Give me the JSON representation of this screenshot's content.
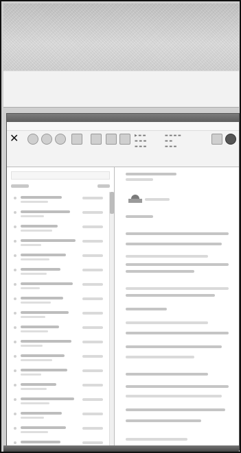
{
  "window": {
    "title": ""
  },
  "menubar": {
    "items": [
      "",
      ""
    ]
  },
  "ribbon": {
    "delete_glyph": "✕",
    "groups": [
      "",
      "",
      ""
    ],
    "buttons": [
      "",
      "",
      "",
      "",
      "",
      "",
      "",
      "",
      "",
      "",
      "",
      ""
    ]
  },
  "colors": {
    "frame_border": "#111111",
    "app_background": "#ffffff",
    "ribbon_background": "#f3f3f3",
    "text_placeholder": "#c5c5c5"
  },
  "icons": {
    "delete": "close-icon",
    "help": "help-icon",
    "avatar": "person-icon"
  },
  "message_list": {
    "items": [
      {
        "subject": "",
        "date": ""
      },
      {
        "subject": "",
        "date": ""
      },
      {
        "subject": "",
        "date": ""
      },
      {
        "subject": "",
        "date": ""
      },
      {
        "subject": "",
        "date": ""
      },
      {
        "subject": "",
        "date": ""
      },
      {
        "subject": "",
        "date": ""
      },
      {
        "subject": "",
        "date": ""
      },
      {
        "subject": "",
        "date": ""
      },
      {
        "subject": "",
        "date": ""
      },
      {
        "subject": "",
        "date": ""
      },
      {
        "subject": "",
        "date": ""
      },
      {
        "subject": "",
        "date": ""
      },
      {
        "subject": "",
        "date": ""
      },
      {
        "subject": "",
        "date": ""
      },
      {
        "subject": "",
        "date": ""
      },
      {
        "subject": "",
        "date": ""
      },
      {
        "subject": "",
        "date": ""
      }
    ]
  },
  "reading_pane": {
    "subject": "",
    "sender": "",
    "body_lines": []
  }
}
